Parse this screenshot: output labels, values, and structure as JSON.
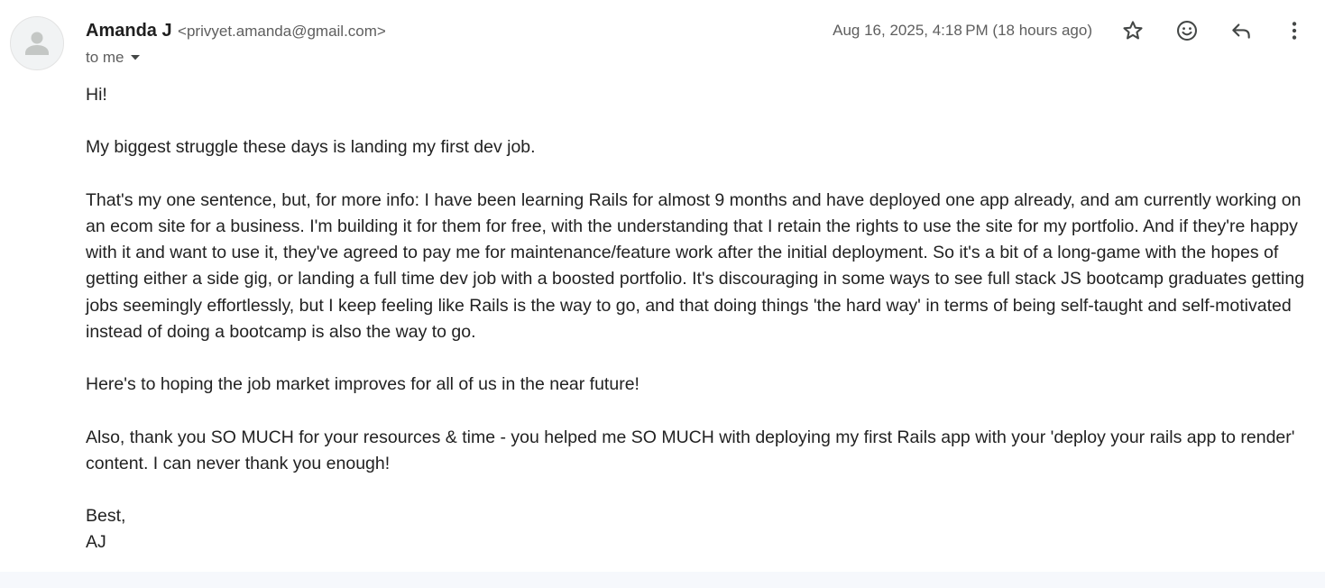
{
  "sender": {
    "name": "Amanda J",
    "email": "<privyet.amanda@gmail.com>",
    "recipient_label": "to me"
  },
  "timestamp": "Aug 16, 2025, 4:18 PM (18 hours ago)",
  "actions": {
    "star_icon": "star-icon",
    "emoji_icon": "emoji-reaction-icon",
    "reply_icon": "reply-icon",
    "more_icon": "more-vertical-icon"
  },
  "body": {
    "greeting": "Hi!",
    "p1": "My biggest struggle these days is landing my first dev job.",
    "p2": "That's my one sentence, but, for more info: I have been learning Rails for almost 9 months and have deployed one app already, and am currently working on an ecom site for a business. I'm building it for them for free, with the understanding that I retain the rights to use the site for my portfolio. And if they're happy with it and want to use it, they've agreed to pay me for maintenance/feature work after the initial deployment. So it's a bit of a long-game with the hopes of getting either a side gig, or landing a full time dev job with a boosted portfolio. It's discouraging in some ways to see full stack JS bootcamp graduates getting jobs seemingly effortlessly, but I keep feeling like Rails is the way to go, and that doing things 'the hard way' in terms of being self-taught and self-motivated instead of doing a bootcamp is also the way to go.",
    "p3": "Here's to hoping the job market improves for all of us in the near future!",
    "p4": "Also, thank you SO MUCH for your resources & time - you helped me SO MUCH with deploying my first Rails app with your 'deploy your rails app to render' content. I can never thank you enough!",
    "signoff": "Best,",
    "signature": "AJ"
  },
  "colors": {
    "text": "#1f1f1f",
    "muted": "#5e5e5e",
    "icon": "#444746",
    "avatar_bg": "#f1f3f4",
    "avatar_figure": "#c4c7c5",
    "footer_bg": "#f6f8fc"
  }
}
